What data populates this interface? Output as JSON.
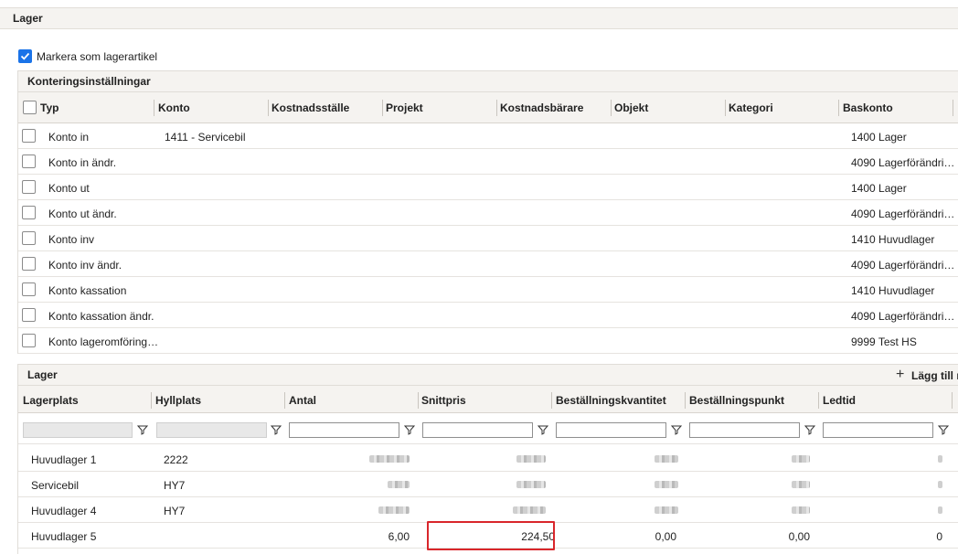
{
  "panel": {
    "title": "Lager"
  },
  "stock_item": {
    "label": "Markera som lagerartikel",
    "checked": true
  },
  "accounts": {
    "title": "Konteringsinställningar",
    "columns": [
      "Typ",
      "Konto",
      "Kostnadsställe",
      "Projekt",
      "Kostnadsbärare",
      "Objekt",
      "Kategori",
      "Baskonto"
    ],
    "rows": [
      {
        "typ": "Konto in",
        "konto": "1411 - Servicebil",
        "baskonto": "1400 Lager"
      },
      {
        "typ": "Konto in ändr.",
        "konto": "",
        "baskonto": "4090 Lagerförändri…"
      },
      {
        "typ": "Konto ut",
        "konto": "",
        "baskonto": "1400 Lager"
      },
      {
        "typ": "Konto ut ändr.",
        "konto": "",
        "baskonto": "4090 Lagerförändri…"
      },
      {
        "typ": "Konto inv",
        "konto": "",
        "baskonto": "1410 Huvudlager"
      },
      {
        "typ": "Konto inv ändr.",
        "konto": "",
        "baskonto": "4090 Lagerförändri…"
      },
      {
        "typ": "Konto kassation",
        "konto": "",
        "baskonto": "1410 Huvudlager"
      },
      {
        "typ": "Konto kassation ändr.",
        "konto": "",
        "baskonto": "4090 Lagerförändri…"
      },
      {
        "typ": "Konto lageromföring…",
        "konto": "",
        "baskonto": "9999 Test HS"
      }
    ]
  },
  "stock": {
    "title": "Lager",
    "add_row_label": "Lägg till ra",
    "columns": [
      "Lagerplats",
      "Hyllplats",
      "Antal",
      "Snittpris",
      "Beställningskvantitet",
      "Beställningspunkt",
      "Ledtid"
    ],
    "rows": [
      {
        "lagerplats": "Huvudlager 1",
        "hyllplats": "2222",
        "antal": "",
        "snittpris": "",
        "bestkvant": "",
        "bestpunkt": "",
        "ledtid": ""
      },
      {
        "lagerplats": "Servicebil",
        "hyllplats": "HY7",
        "antal": "",
        "snittpris": "",
        "bestkvant": "",
        "bestpunkt": "",
        "ledtid": ""
      },
      {
        "lagerplats": "Huvudlager 4",
        "hyllplats": "HY7",
        "antal": "",
        "snittpris": "",
        "bestkvant": "",
        "bestpunkt": "",
        "ledtid": ""
      },
      {
        "lagerplats": "Huvudlager 5",
        "hyllplats": "",
        "antal": "6,00",
        "snittpris": "224,50",
        "bestkvant": "0,00",
        "bestpunkt": "0,00",
        "ledtid": "0"
      }
    ]
  },
  "colors": {
    "accent": "#1a73e8",
    "highlight": "#d9262b",
    "header_bg": "#f5f3f0"
  }
}
